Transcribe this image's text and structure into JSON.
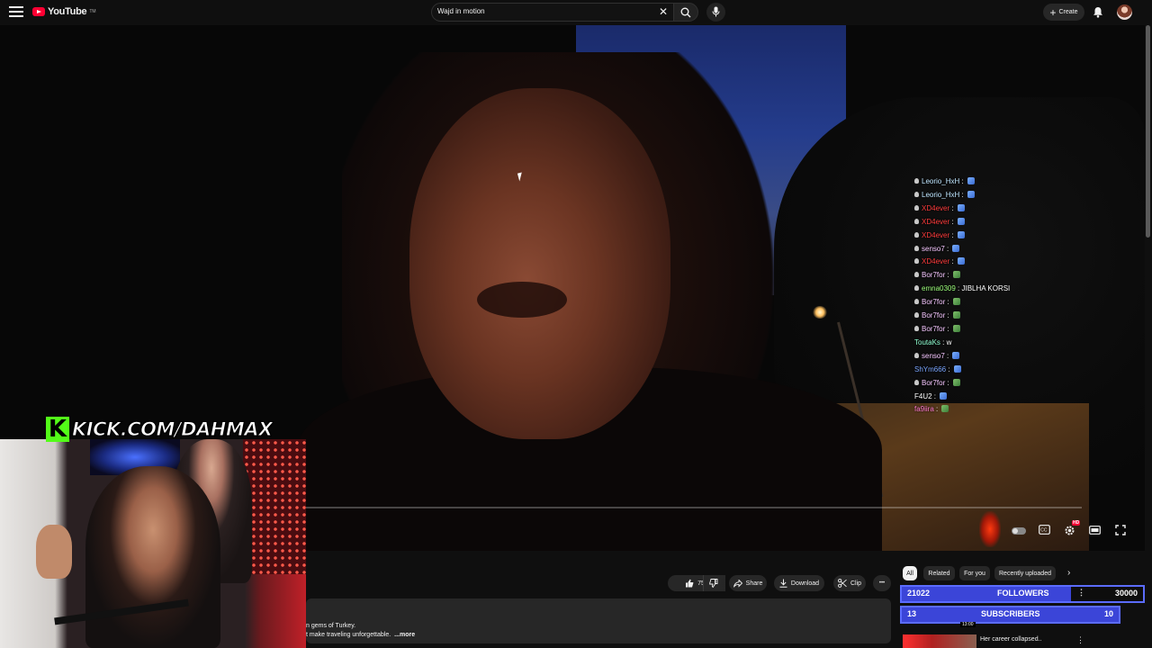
{
  "header": {
    "logo_text": "YouTube",
    "logo_tm": "TM",
    "search_value": "Wajd in motion",
    "create_label": "Create"
  },
  "player": {
    "progress_fraction": 0.0,
    "hd_badge": "HD"
  },
  "chat": [
    {
      "user": "Leorio_HxH",
      "color": "#bfe6ff",
      "sep": " : ",
      "text": "",
      "emote": "e-blue",
      "badge": true
    },
    {
      "user": "Leorio_HxH",
      "color": "#bfe6ff",
      "sep": " : ",
      "text": "",
      "emote": "e-blue",
      "badge": true
    },
    {
      "user": "XD4ever",
      "color": "#ff3b3b",
      "sep": " : ",
      "text": "",
      "emote": "e-blue",
      "badge": true
    },
    {
      "user": "XD4ever",
      "color": "#ff3b3b",
      "sep": " : ",
      "text": "",
      "emote": "e-blue",
      "badge": true
    },
    {
      "user": "XD4ever",
      "color": "#ff3b3b",
      "sep": " : ",
      "text": "",
      "emote": "e-blue",
      "badge": true
    },
    {
      "user": "senso7",
      "color": "#f6c7ff",
      "sep": " : ",
      "text": "",
      "emote": "e-blue",
      "badge": true
    },
    {
      "user": "XD4ever",
      "color": "#ff3b3b",
      "sep": " : ",
      "text": "",
      "emote": "e-blue",
      "badge": true
    },
    {
      "user": "Bor7for",
      "color": "#f6c7ff",
      "sep": " : ",
      "text": "",
      "emote": "e-green",
      "badge": true
    },
    {
      "user": "emna0309",
      "color": "#9cff7a",
      "sep": " : ",
      "text": "JIBLHA KORSI",
      "emote": "",
      "badge": true
    },
    {
      "user": "Bor7for",
      "color": "#f6c7ff",
      "sep": " : ",
      "text": "",
      "emote": "e-green",
      "badge": true
    },
    {
      "user": "Bor7for",
      "color": "#f6c7ff",
      "sep": " : ",
      "text": "",
      "emote": "e-green",
      "badge": true
    },
    {
      "user": "Bor7for",
      "color": "#f6c7ff",
      "sep": " : ",
      "text": "",
      "emote": "e-green",
      "badge": true
    },
    {
      "user": "ToutaKs",
      "color": "#8fffd2",
      "sep": " : ",
      "text": "w",
      "emote": "",
      "badge": false
    },
    {
      "user": "senso7",
      "color": "#f6c7ff",
      "sep": " : ",
      "text": "",
      "emote": "e-blue",
      "badge": true
    },
    {
      "user": "ShYm666",
      "color": "#7aa6ff",
      "sep": " : ",
      "text": "",
      "emote": "e-blue",
      "badge": false
    },
    {
      "user": "Bor7for",
      "color": "#f6c7ff",
      "sep": " : ",
      "text": "",
      "emote": "e-green",
      "badge": true
    },
    {
      "user": "F4U2",
      "color": "#ffffff",
      "sep": " : ",
      "text": "",
      "emote": "e-blue",
      "badge": false
    },
    {
      "user": "fa9iira",
      "color": "#ff7ad0",
      "sep": " : ",
      "text": "",
      "emote": "e-green",
      "badge": false
    }
  ],
  "overlay": {
    "kick_url": "KICK.COM/DAHMAX",
    "kick_letter": "K"
  },
  "actions": {
    "like_count": "754",
    "share_label": "Share",
    "download_label": "Download",
    "clip_label": "Clip",
    "more_label": "•••"
  },
  "description": {
    "line1": "n gems of Turkey.",
    "line2": "t make traveling unforgettable.",
    "more": "...more"
  },
  "chips": [
    "All",
    "Related",
    "For you",
    "Recently uploaded"
  ],
  "goals": {
    "followers": {
      "current": "21022",
      "label": "FOLLOWERS",
      "target": "30000",
      "fraction": 0.7
    },
    "subscribers": {
      "current": "13",
      "label": "SUBSCRIBERS",
      "target": "10",
      "fraction": 1.0
    }
  },
  "recommendation": {
    "duration": "13:00",
    "title": "Her career collapsed.."
  },
  "icons": {
    "menu": "hamburger-menu-icon",
    "search": "search-icon",
    "mic": "mic-icon",
    "bell": "bell-icon",
    "like": "thumbs-up-icon",
    "dislike": "thumbs-down-icon",
    "share": "share-arrow-icon",
    "download": "download-icon",
    "clip": "scissors-icon",
    "captions": "cc-icon",
    "settings": "gear-icon",
    "theater": "theater-mode-icon",
    "fullscreen": "fullscreen-icon"
  },
  "colors": {
    "brand_red": "#ff0033",
    "kick_green": "#53fc18",
    "goal_blue": "#3b45d8"
  }
}
